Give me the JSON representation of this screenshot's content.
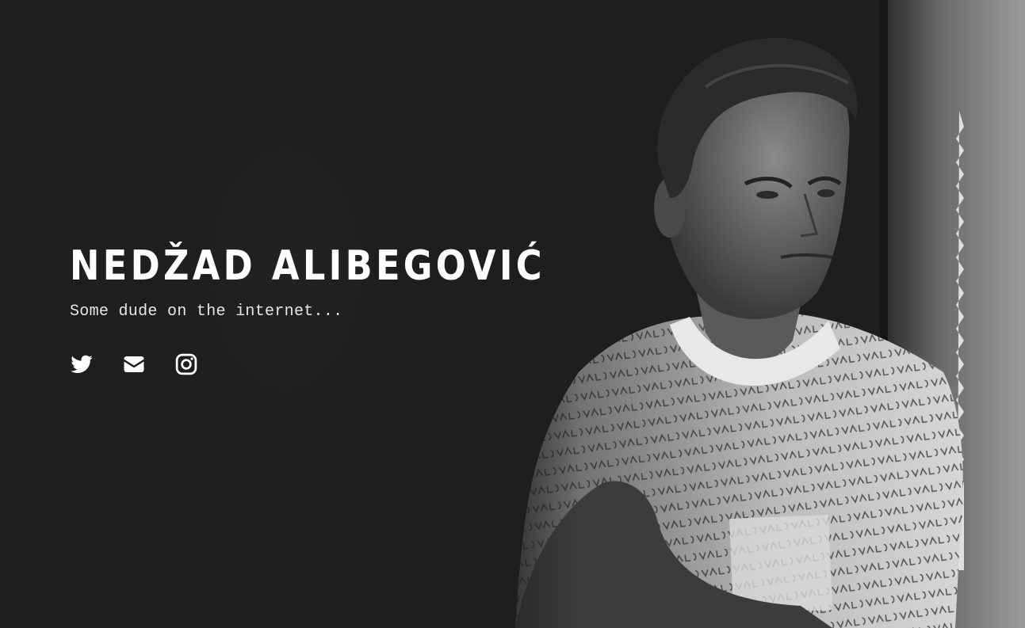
{
  "profile": {
    "name": "NEDŽAD ALIBEGOVIĆ",
    "tagline": "Some dude on the internet..."
  },
  "socials": [
    {
      "icon": "twitter-icon",
      "label": "Twitter"
    },
    {
      "icon": "envelope-icon",
      "label": "Email"
    },
    {
      "icon": "instagram-icon",
      "label": "Instagram"
    }
  ],
  "colors": {
    "background": "#1f1e1f",
    "text": "#ffffff",
    "muted": "#e6e6e6"
  }
}
